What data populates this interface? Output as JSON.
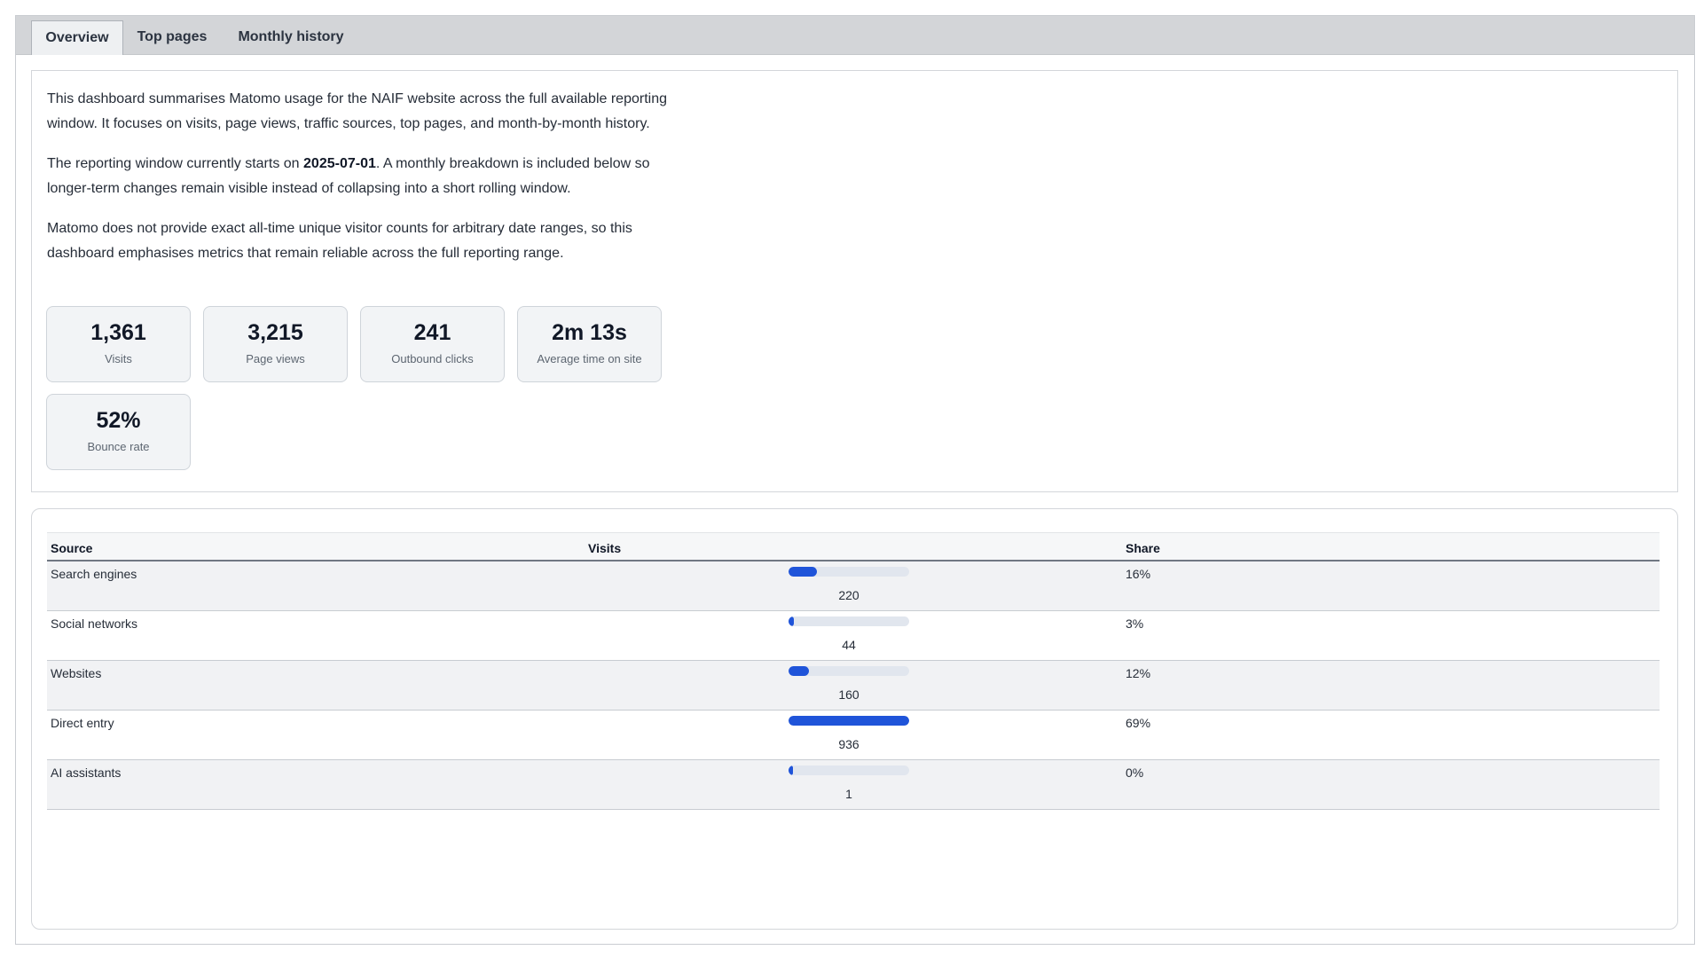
{
  "tabs": [
    "Overview",
    "Top pages",
    "Monthly history"
  ],
  "intro": {
    "p1": "This dashboard summarises Matomo usage for the NAIF website across the full available reporting window. It focuses on visits, page views, traffic sources, top pages, and month-by-month history.",
    "p2_before": "The reporting window currently starts on ",
    "p2_date": "2025-07-01",
    "p2_after": ". A monthly breakdown is included below so longer-term changes remain visible instead of collapsing into a short rolling window.",
    "p3": "Matomo does not provide exact all-time unique visitor counts for arbitrary date ranges, so this dashboard emphasises metrics that remain reliable across the full reporting range."
  },
  "metrics": [
    {
      "value": "1,361",
      "label": "Visits"
    },
    {
      "value": "3,215",
      "label": "Page views"
    },
    {
      "value": "241",
      "label": "Outbound clicks"
    },
    {
      "value": "2m 13s",
      "label": "Average time on site"
    },
    {
      "value": "52%",
      "label": "Bounce rate"
    }
  ],
  "sources": {
    "headers": [
      "Source",
      "Visits",
      "Share"
    ],
    "rows": [
      {
        "source": "Search engines",
        "visits": "220",
        "share": "16%",
        "fraction": 0.235
      },
      {
        "source": "Social networks",
        "visits": "44",
        "share": "3%",
        "fraction": 0.047
      },
      {
        "source": "Websites",
        "visits": "160",
        "share": "12%",
        "fraction": 0.171
      },
      {
        "source": "Direct entry",
        "visits": "936",
        "share": "69%",
        "fraction": 1.0
      },
      {
        "source": "AI assistants",
        "visits": "1",
        "share": "0%",
        "fraction": 0.001
      }
    ]
  },
  "colors": {
    "accent": "#1f54d9",
    "bar_track": "#e1e6ee"
  }
}
